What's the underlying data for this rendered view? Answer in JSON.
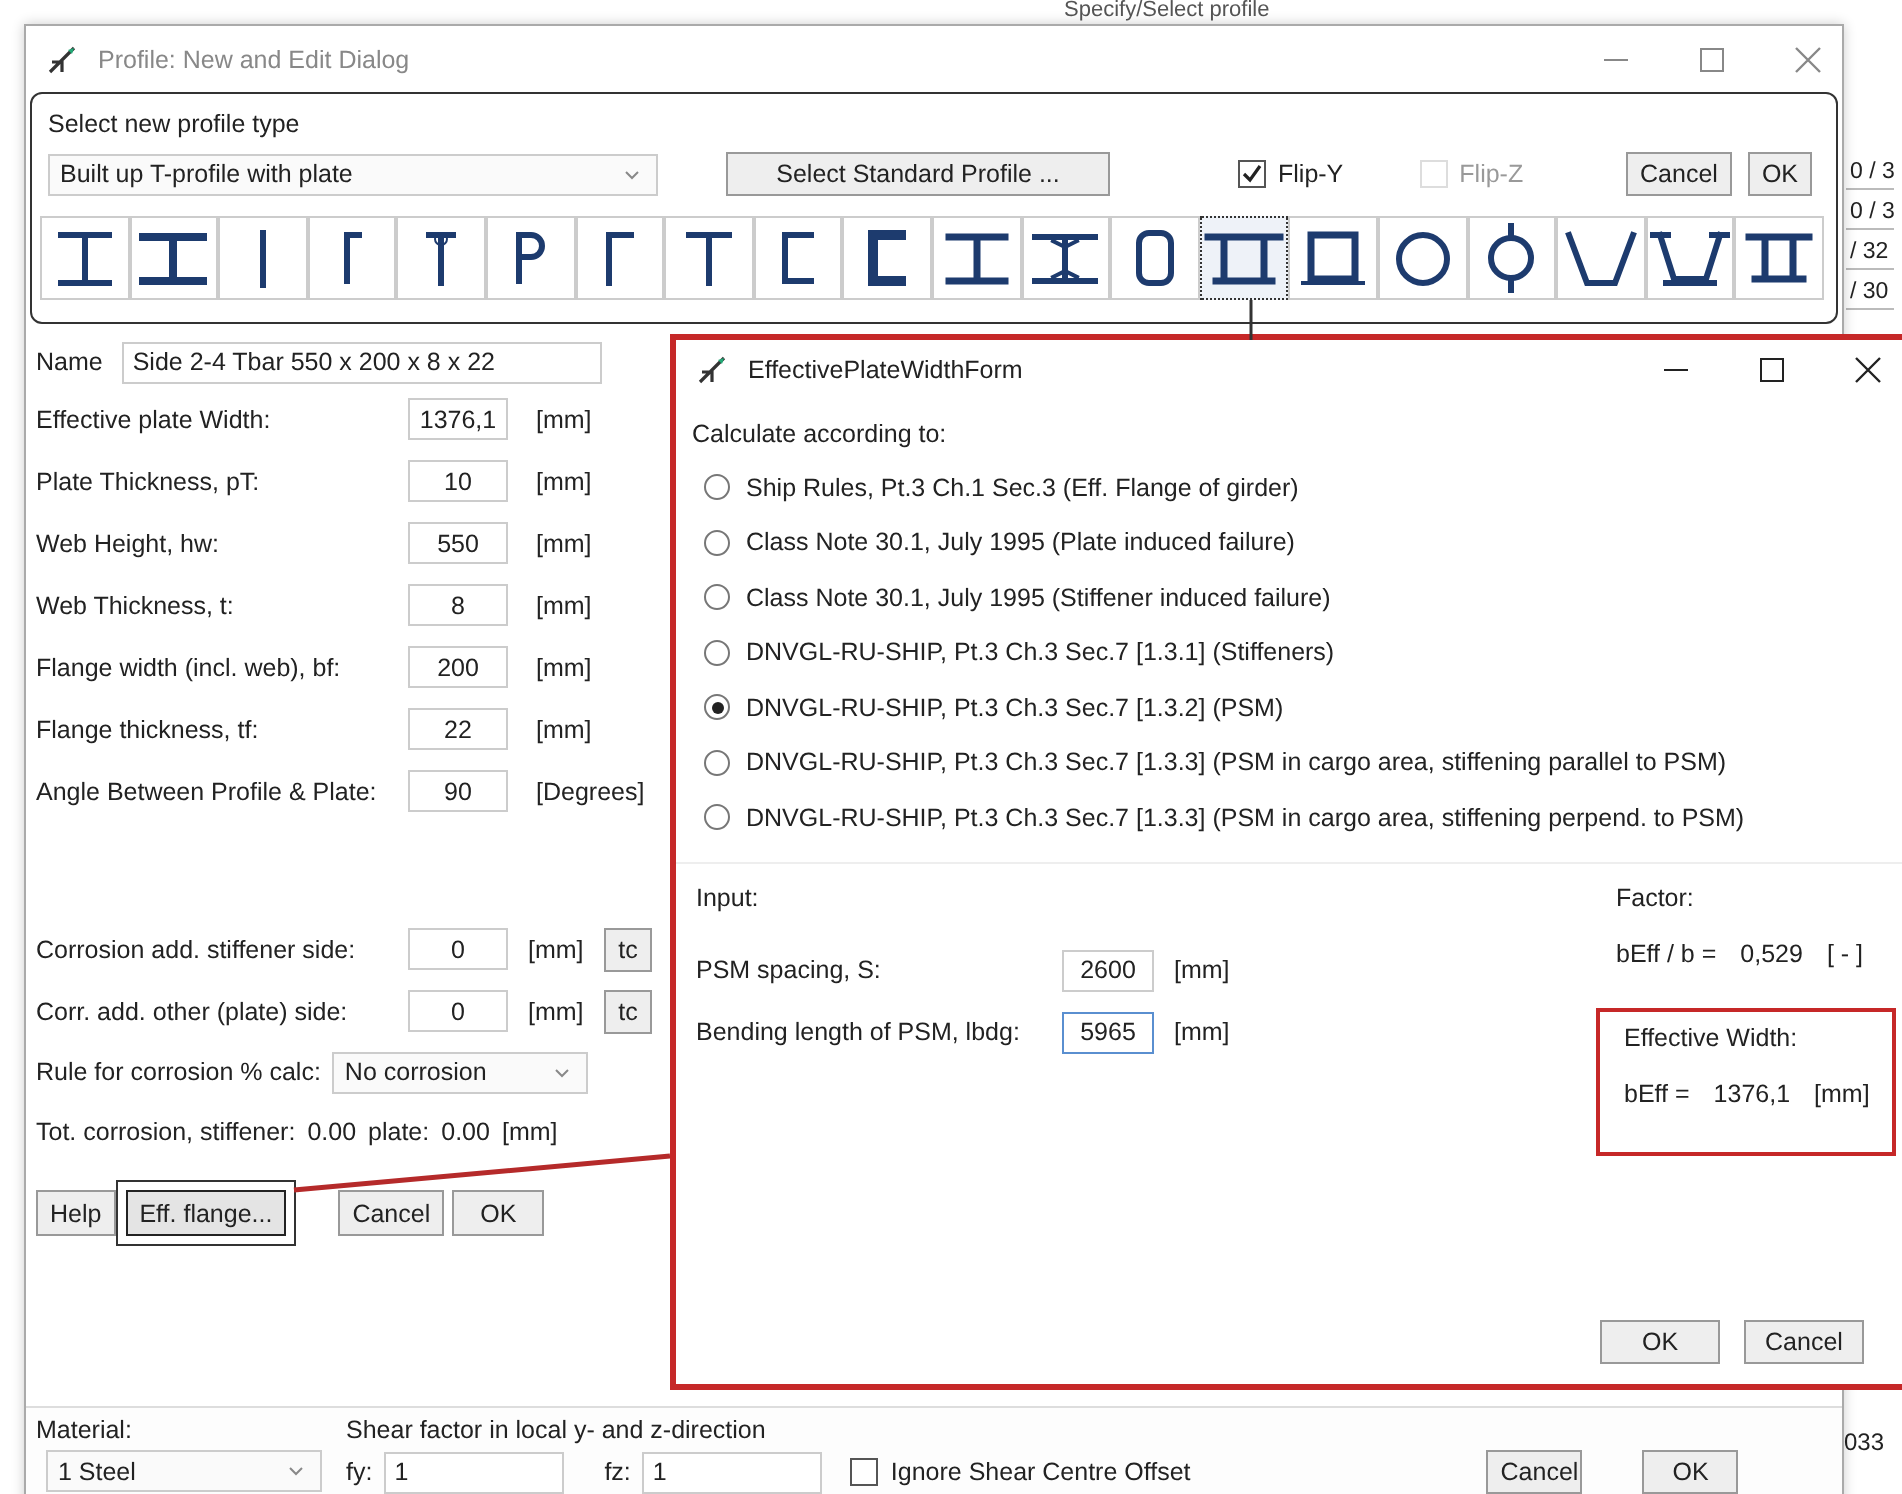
{
  "background_app": {
    "heading": "Specify/Select profile",
    "column_fragments": [
      "0 / 3",
      "0 / 3",
      "/ 32",
      "/ 30"
    ],
    "bottom_fragment": "033"
  },
  "profile_dialog": {
    "title": "Profile: New and Edit Dialog",
    "profile_type": {
      "label": "Select new profile type",
      "value": "Built up T-profile with plate"
    },
    "standard_profile_button": "Select Standard Profile ...",
    "flips": [
      {
        "label": "Flip-Y",
        "checked": true,
        "disabled": false
      },
      {
        "label": "Flip-Z",
        "checked": false,
        "disabled": true
      }
    ],
    "top_buttons": [
      "Cancel",
      "OK"
    ],
    "profile_shapes": [
      {
        "selected": false
      },
      {
        "selected": false
      },
      {
        "selected": false
      },
      {
        "selected": false
      },
      {
        "selected": false
      },
      {
        "selected": false
      },
      {
        "selected": false
      },
      {
        "selected": false
      },
      {
        "selected": false
      },
      {
        "selected": false
      },
      {
        "selected": false
      },
      {
        "selected": false
      },
      {
        "selected": false
      },
      {
        "selected": true
      },
      {
        "selected": false
      },
      {
        "selected": false
      },
      {
        "selected": false
      },
      {
        "selected": false
      },
      {
        "selected": false
      },
      {
        "selected": false
      }
    ],
    "name": {
      "label": "Name",
      "value": "Side 2-4 Tbar 550 x 200 x 8 x 22"
    },
    "fields": [
      {
        "label": "Effective plate Width:",
        "value": "1376,1",
        "unit": "[mm]"
      },
      {
        "label": "Plate Thickness, pT:",
        "value": "10",
        "unit": "[mm]"
      },
      {
        "label": "Web Height, hw:",
        "value": "550",
        "unit": "[mm]"
      },
      {
        "label": "Web Thickness, t:",
        "value": "8",
        "unit": "[mm]"
      },
      {
        "label": "Flange width (incl. web), bf:",
        "value": "200",
        "unit": "[mm]"
      },
      {
        "label": "Flange thickness, tf:",
        "value": "22",
        "unit": "[mm]"
      },
      {
        "label": "Angle Between Profile & Plate:",
        "value": "90",
        "unit": "[Degrees]"
      }
    ],
    "corrosion_fields": [
      {
        "label": "Corrosion add. stiffener side:",
        "value": "0",
        "unit": "[mm]",
        "button": "tc"
      },
      {
        "label": "Corr. add. other (plate) side:",
        "value": "0",
        "unit": "[mm]",
        "button": "tc"
      }
    ],
    "corrosion_rule": {
      "label": "Rule for corrosion % calc:",
      "value": "No corrosion"
    },
    "total_corrosion": {
      "label": "Tot. corrosion, stiffener:",
      "stiffener": "0.00",
      "plate_label": "plate:",
      "plate": "0.00",
      "unit": "[mm]"
    },
    "buttons": [
      {
        "label": "Help",
        "highlighted": false
      },
      {
        "label": "Eff. flange...",
        "highlighted": true
      },
      {
        "label": "Cancel",
        "highlighted": false
      },
      {
        "label": "OK",
        "highlighted": false
      }
    ],
    "material": {
      "label": "Material:",
      "value": "1 Steel"
    },
    "shear": {
      "label": "Shear factor in local y- and z-direction",
      "fy_label": "fy:",
      "fy": "1",
      "fz_label": "fz:",
      "fz": "1"
    },
    "ignore_shear": {
      "label": "Ignore Shear Centre Offset",
      "checked": false
    },
    "bottom_buttons": [
      "Cancel",
      "OK"
    ]
  },
  "effective_width_form": {
    "title": "EffectivePlateWidthForm",
    "heading": "Calculate according to:",
    "options": [
      {
        "label": "Ship Rules, Pt.3 Ch.1 Sec.3 (Eff. Flange of girder)",
        "selected": false
      },
      {
        "label": "Class Note 30.1, July 1995 (Plate induced failure)",
        "selected": false
      },
      {
        "label": "Class Note 30.1, July 1995 (Stiffener induced failure)",
        "selected": false
      },
      {
        "label": "DNVGL-RU-SHIP, Pt.3 Ch.3 Sec.7 [1.3.1] (Stiffeners)",
        "selected": false
      },
      {
        "label": "DNVGL-RU-SHIP, Pt.3 Ch.3 Sec.7 [1.3.2] (PSM)",
        "selected": true
      },
      {
        "label": "DNVGL-RU-SHIP, Pt.3 Ch.3 Sec.7 [1.3.3] (PSM in cargo area, stiffening parallel to PSM)",
        "selected": false
      },
      {
        "label": "DNVGL-RU-SHIP, Pt.3 Ch.3 Sec.7 [1.3.3] (PSM in cargo area, stiffening perpend. to PSM)",
        "selected": false
      }
    ],
    "input_heading": "Input:",
    "inputs": [
      {
        "label": "PSM spacing, S:",
        "value": "2600",
        "unit": "[mm]",
        "focused": false
      },
      {
        "label": "Bending length of PSM, lbdg:",
        "value": "5965",
        "unit": "[mm]",
        "focused": true
      }
    ],
    "factor": {
      "heading": "Factor:",
      "label": "bEff / b =",
      "value": "0,529",
      "unit": "[ - ]"
    },
    "effective_width": {
      "heading": "Effective Width:",
      "label": "bEff =",
      "value": "1376,1",
      "unit": "[mm]",
      "highlighted": true
    },
    "buttons": [
      "OK",
      "Cancel"
    ]
  }
}
